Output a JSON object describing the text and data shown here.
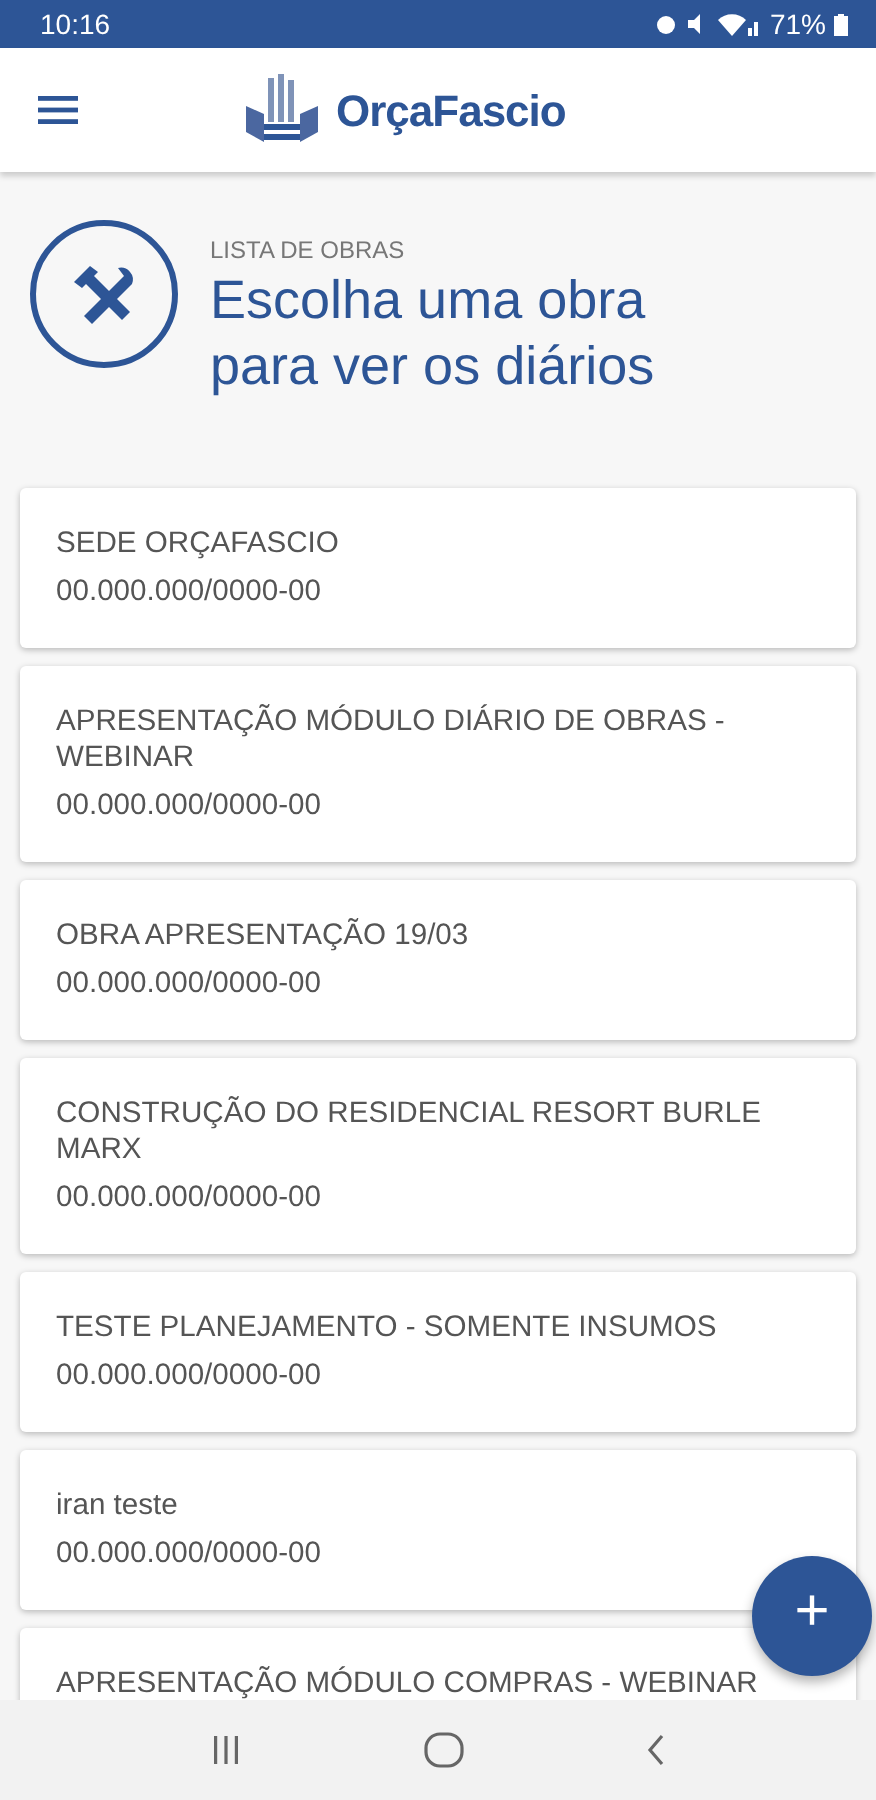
{
  "status_bar": {
    "time": "10:16",
    "battery": "71%"
  },
  "header": {
    "brand": "OrçaFascio"
  },
  "hero": {
    "eyebrow": "LISTA DE OBRAS",
    "title": "Escolha uma obra para ver os diários"
  },
  "obras": [
    {
      "name": "SEDE ORÇAFASCIO",
      "cnpj": "00.000.000/0000-00"
    },
    {
      "name": "APRESENTAÇÃO MÓDULO DIÁRIO DE OBRAS - WEBINAR",
      "cnpj": "00.000.000/0000-00"
    },
    {
      "name": "OBRA APRESENTAÇÃO 19/03",
      "cnpj": "00.000.000/0000-00"
    },
    {
      "name": "CONSTRUÇÃO DO RESIDENCIAL RESORT BURLE MARX",
      "cnpj": "00.000.000/0000-00"
    },
    {
      "name": "TESTE PLANEJAMENTO - SOMENTE INSUMOS",
      "cnpj": "00.000.000/0000-00"
    },
    {
      "name": "iran teste",
      "cnpj": "00.000.000/0000-00"
    },
    {
      "name": "APRESENTAÇÃO MÓDULO COMPRAS - WEBINAR"
    }
  ],
  "fab": {
    "label": "+"
  }
}
